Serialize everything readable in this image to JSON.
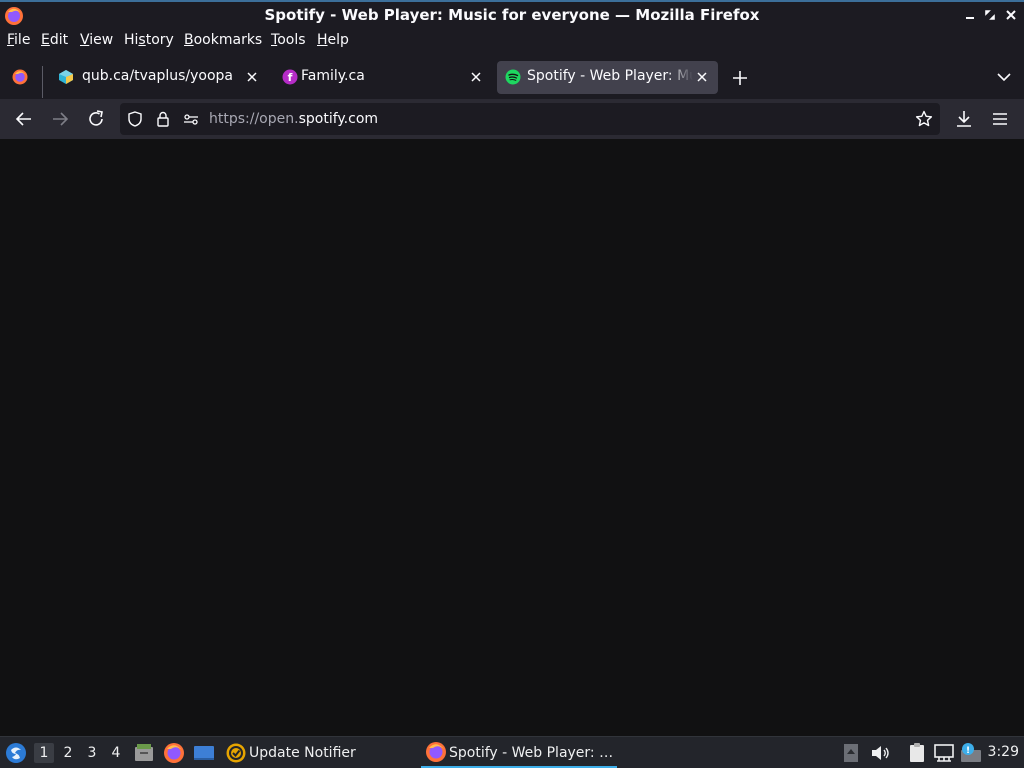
{
  "window": {
    "title": "Spotify - Web Player: Music for everyone — Mozilla Firefox",
    "controls": {
      "minimize": "minimize-icon",
      "maximize": "maximize-icon",
      "close": "close-icon"
    }
  },
  "menubar": {
    "items": [
      {
        "label": "File",
        "accel": "F",
        "rest": "ile"
      },
      {
        "label": "Edit",
        "accel": "E",
        "rest": "dit"
      },
      {
        "label": "View",
        "accel": "V",
        "rest": "iew"
      },
      {
        "label": "History",
        "accel": "",
        "pre": "Hi",
        "accelmid": "s",
        "rest": "tory"
      },
      {
        "label": "Bookmarks",
        "accel": "B",
        "rest": "ookmarks"
      },
      {
        "label": "Tools",
        "accel": "T",
        "rest": "ools"
      },
      {
        "label": "Help",
        "accel": "H",
        "rest": "elp"
      }
    ]
  },
  "tabs": [
    {
      "label": "qub.ca/tvaplus/yoopa",
      "favicon": "qub-icon",
      "active": false
    },
    {
      "label": "Family.ca",
      "favicon": "family-icon",
      "active": false
    },
    {
      "label": "Spotify - Web Player: Music for everyone",
      "favicon": "spotify-icon",
      "active": true
    }
  ],
  "navbar": {
    "url_prefix": "https://open.",
    "url_domain": "spotify.com"
  },
  "taskbar": {
    "workspaces": [
      "1",
      "2",
      "3",
      "4"
    ],
    "active_workspace": "1",
    "tasks": [
      {
        "label": "Update Notifier",
        "icon": "update-notifier-icon",
        "active": false
      },
      {
        "label": "Spotify - Web Player: …",
        "icon": "firefox-icon",
        "active": true
      }
    ],
    "clock": "3:29"
  },
  "colors": {
    "chrome_bg": "#1c1b22",
    "toolbar_bg": "#2b2a33",
    "active_tab_bg": "#42414d",
    "content_bg": "#111112",
    "spotify_green": "#1ed760",
    "taskbar_bg": "#23252b",
    "taskbar_accent": "#3daee9"
  }
}
